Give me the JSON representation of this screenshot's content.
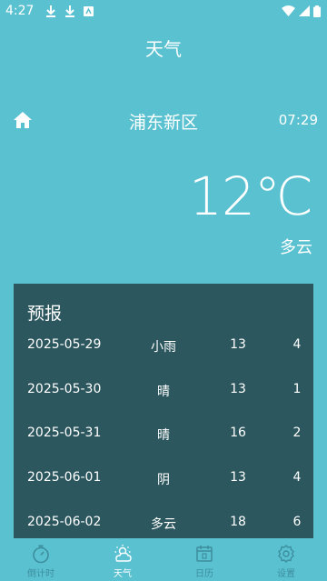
{
  "status_bar": {
    "time": "4:27",
    "icons": [
      "download-icon",
      "download-icon",
      "app-badge-icon",
      "wifi-icon",
      "signal-icon",
      "battery-icon"
    ]
  },
  "app": {
    "title": "天气"
  },
  "location": {
    "city": "浦东新区",
    "update_time": "07:29"
  },
  "current": {
    "temperature": "12℃",
    "condition": "多云"
  },
  "forecast": {
    "title": "预报",
    "days": [
      {
        "date": "2025-05-29",
        "condition": "小雨",
        "high": "13",
        "low": "4"
      },
      {
        "date": "2025-05-30",
        "condition": "晴",
        "high": "13",
        "low": "1"
      },
      {
        "date": "2025-05-31",
        "condition": "晴",
        "high": "16",
        "low": "2"
      },
      {
        "date": "2025-06-01",
        "condition": "阴",
        "high": "13",
        "low": "4"
      },
      {
        "date": "2025-06-02",
        "condition": "多云",
        "high": "18",
        "low": "6"
      }
    ]
  },
  "nav": {
    "items": [
      {
        "label": "倒计时",
        "icon": "stopwatch-icon",
        "active": false
      },
      {
        "label": "天气",
        "icon": "weather-icon",
        "active": true
      },
      {
        "label": "日历",
        "icon": "calendar-icon",
        "active": false
      },
      {
        "label": "设置",
        "icon": "gear-icon",
        "active": false
      }
    ]
  },
  "colors": {
    "background": "#5ac1d1",
    "panel": "#2c575e",
    "text": "#ffffff",
    "nav_inactive": "#3d8e9c"
  }
}
